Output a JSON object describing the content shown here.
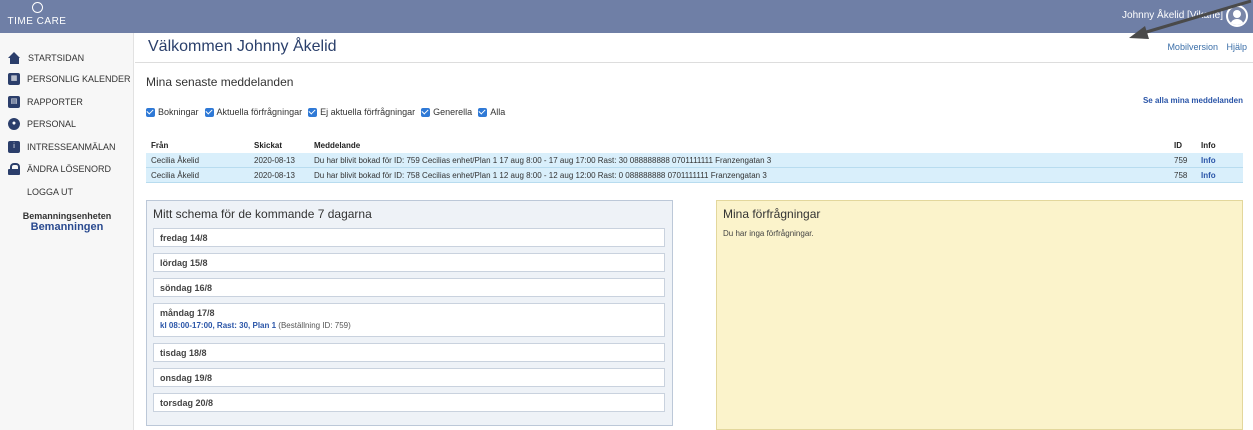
{
  "header": {
    "logo_text": "TIME CARE",
    "user_label": "Johnny Åkelid [Vikarie]"
  },
  "sidebar": {
    "items": [
      {
        "label": "STARTSIDAN"
      },
      {
        "label": "PERSONLIG KALENDER"
      },
      {
        "label": "RAPPORTER"
      },
      {
        "label": "PERSONAL"
      },
      {
        "label": "INTRESSEANMÄLAN"
      },
      {
        "label": "ÄNDRA LÖSENORD"
      },
      {
        "label": "LOGGA UT"
      }
    ],
    "unit_label": "Bemanningsenheten",
    "unit_name": "Bemanningen"
  },
  "main": {
    "welcome": "Välkommen Johnny Åkelid",
    "links": {
      "mobile": "Mobilversion",
      "help": "Hjälp"
    },
    "messages_title": "Mina senaste meddelanden",
    "see_all": "Se alla mina meddelanden",
    "filters": [
      {
        "label": "Bokningar",
        "checked": true
      },
      {
        "label": "Aktuella förfrågningar",
        "checked": true
      },
      {
        "label": "Ej aktuella förfrågningar",
        "checked": true
      },
      {
        "label": "Generella",
        "checked": true
      },
      {
        "label": "Alla",
        "checked": true
      }
    ],
    "table": {
      "columns": [
        "Från",
        "Skickat",
        "Meddelande",
        "ID",
        "Info"
      ],
      "rows": [
        {
          "from": "Cecilia Åkelid",
          "sent": "2020-08-13",
          "message": "Du har blivit bokad för ID: 759 Cecilias enhet/Plan 1 17 aug 8:00 - 17 aug 17:00 Rast: 30 088888888 0701111111 Franzengatan 3",
          "id": "759",
          "info": "Info"
        },
        {
          "from": "Cecilia Åkelid",
          "sent": "2020-08-13",
          "message": "Du har blivit bokad för ID: 758 Cecilias enhet/Plan 1 12 aug 8:00 - 12 aug 12:00 Rast: 0 088888888 0701111111 Franzengatan 3",
          "id": "758",
          "info": "Info"
        }
      ]
    },
    "schedule": {
      "title": "Mitt schema för de kommande 7 dagarna",
      "days": [
        {
          "label": "fredag 14/8"
        },
        {
          "label": "lördag 15/8"
        },
        {
          "label": "söndag 16/8"
        },
        {
          "label": "måndag 17/8",
          "shift": "kl 08:00-17:00, Rast: 30, Plan 1",
          "order": "(Beställning ID: 759)"
        },
        {
          "label": "tisdag 18/8"
        },
        {
          "label": "onsdag 19/8"
        },
        {
          "label": "torsdag 20/8"
        }
      ]
    },
    "requests": {
      "title": "Mina förfrågningar",
      "empty_text": "Du har inga förfrågningar."
    }
  },
  "colors": {
    "topbar": "#6f7fa6",
    "accent": "#2a55a8",
    "row_highlight": "#d9effb",
    "requests_bg": "#fbf3cb"
  }
}
